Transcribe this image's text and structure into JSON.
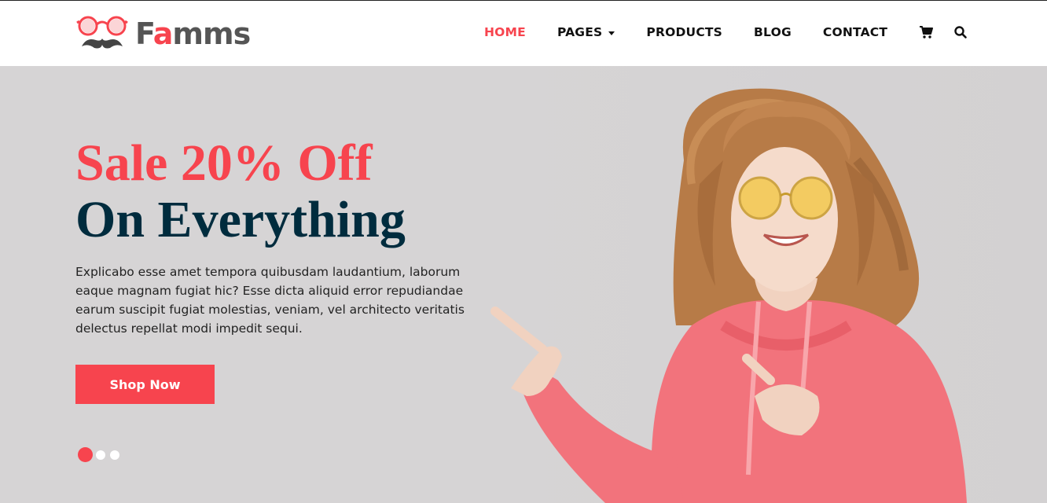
{
  "brand": {
    "name_prefix": "F",
    "name_accent": "a",
    "name_suffix": "mms",
    "logo_icon": "glasses-mustache-icon",
    "accent_color": "#f7444e",
    "dark_color": "#002c3e"
  },
  "nav": {
    "home": "HOME",
    "pages": "PAGES",
    "products": "PRODUCTS",
    "blog": "BLOG",
    "contact": "CONTACT",
    "cart_icon": "cart-icon",
    "search_icon": "search-icon"
  },
  "hero": {
    "title_line1": "Sale 20% Off",
    "title_line2": "On Everything",
    "description": "Explicabo esse amet tempora quibusdam laudantium, laborum eaque magnam fugiat hic? Esse dicta aliquid error repudiandae earum suscipit fugiat molestias, veniam, vel architecto veritatis delectus repellat modi impedit sequi.",
    "button_label": "Shop Now",
    "slides_total": 3,
    "slide_active": 1
  }
}
